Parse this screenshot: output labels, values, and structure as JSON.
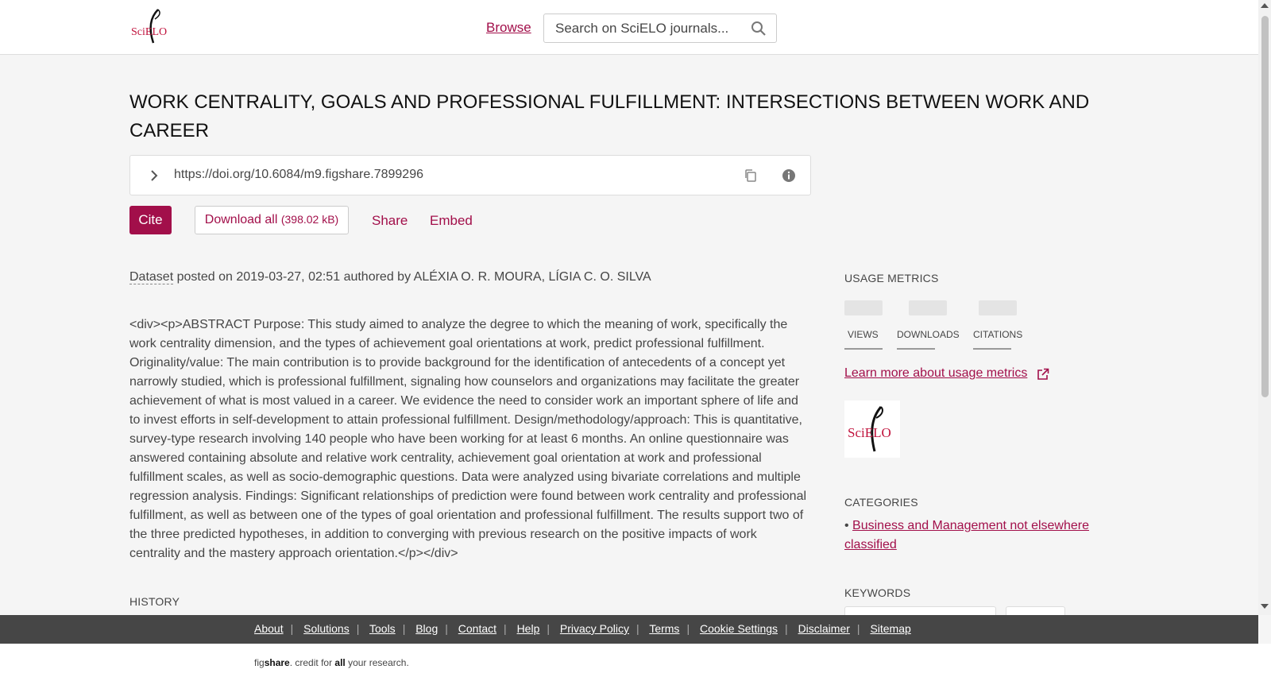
{
  "header": {
    "logo_text": "SciELO",
    "browse_label": "Browse",
    "search_placeholder": "Search on SciELO journals..."
  },
  "article": {
    "title": "WORK CENTRALITY, GOALS AND PROFESSIONAL FULFILLMENT: INTERSECTIONS BETWEEN WORK AND CAREER",
    "doi": "https://doi.org/10.6084/m9.figshare.7899296",
    "actions": {
      "cite": "Cite",
      "download": "Download all",
      "download_size": "(398.02 kB)",
      "share": "Share",
      "embed": "Embed"
    },
    "meta": {
      "type": "Dataset",
      "posted_prefix": "posted on",
      "date": "2019-03-27, 02:51",
      "authored_prefix": "authored by",
      "authors": "ALÉXIA O. R. MOURA, LÍGIA C. O. SILVA"
    },
    "abstract": "<div><p>ABSTRACT Purpose: This study aimed to analyze the degree to which the meaning of work, specifically the work centrality dimension, and the types of achievement goal orientations at work, predict professional fulfillment. Originality/value: The main contribution is to provide background for the identification of antecedents of a concept yet narrowly studied, which is professional fulfillment, signaling how counselors and organizations may facilitate the greater achievement of what is most valued in a career. We evidence the need to consider work an important sphere of life and to invest efforts in self-development to attain professional fulfillment. Design/methodology/approach: This is quantitative, survey-type research involving 140 people who have been working for at least 6 months. An online questionnaire was answered containing absolute and relative work centrality, achievement goal orientation at work and professional fulfillment scales, as well as socio-demographic questions. Data were analyzed using bivariate correlations and multiple regression analysis. Findings: Significant relationships of prediction were found between work centrality and professional fulfillment, as well as between one of the types of goal orientation and professional fulfillment. The results support two of the three predicted hypotheses, in addition to converging with previous research on the positive impacts of work centrality and the mastery approach orientation.</p></div>",
    "history_heading": "HISTORY"
  },
  "sidebar": {
    "usage_heading": "USAGE METRICS",
    "metrics": [
      {
        "label": "VIEWS"
      },
      {
        "label": "DOWNLOADS"
      },
      {
        "label": "CITATIONS"
      }
    ],
    "learn_more": "Learn more about usage metrics",
    "thumbnail_text": "SciELO",
    "categories_heading": "CATEGORIES",
    "categories": [
      "Business and Management not elsewhere classified"
    ],
    "keywords_heading": "KEYWORDS"
  },
  "footer": {
    "links": [
      "About",
      "Solutions",
      "Tools",
      "Blog",
      "Contact",
      "Help",
      "Privacy Policy",
      "Terms",
      "Cookie Settings",
      "Disclaimer",
      "Sitemap"
    ],
    "tagline_fig": "fig",
    "tagline_share": "share",
    "tagline_mid": ". credit for ",
    "tagline_all": "all",
    "tagline_end": " your research."
  },
  "colors": {
    "accent": "#a20f4a",
    "background": "#f5f5f5",
    "footer_bar": "#464646"
  }
}
